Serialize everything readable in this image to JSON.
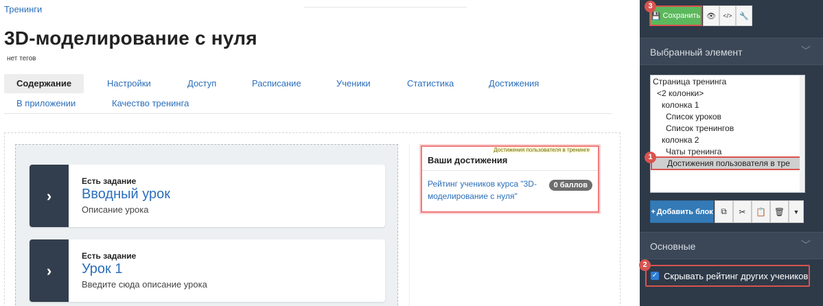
{
  "breadcrumb": "Тренинги",
  "page": {
    "title": "3D-моделирование с нуля",
    "tags": "нет тегов"
  },
  "tabs": [
    {
      "label": "Содержание",
      "active": true
    },
    {
      "label": "Настройки"
    },
    {
      "label": "Доступ"
    },
    {
      "label": "Расписание"
    },
    {
      "label": "Ученики"
    },
    {
      "label": "Статистика"
    },
    {
      "label": "Достижения"
    },
    {
      "label": "В приложении"
    },
    {
      "label": "Качество тренинга"
    }
  ],
  "lessons": [
    {
      "task": "Есть задание",
      "title": "Вводный урок",
      "desc": "Описание урока"
    },
    {
      "task": "Есть задание",
      "title": "Урок 1",
      "desc": "Введите сюда описание урока"
    }
  ],
  "achievements": {
    "caption": "Достижения пользователя в тренинге",
    "title": "Ваши достижения",
    "rating": "Рейтинг учеников курса \"3D-моделирование с нуля\"",
    "badge": "0 баллов"
  },
  "sidebar": {
    "toolbar": {
      "save_label": "Сохранить"
    },
    "selected_section": "Выбранный элемент",
    "tree": [
      "Страница тренинга",
      "<2 колонки>",
      "колонка 1",
      "Список уроков",
      "Список тренингов",
      "колонка 2",
      "Чаты тренинга",
      "Достижения пользователя в тре"
    ],
    "add_block_label": "Добавить блок",
    "main_section": "Основные",
    "hide_rating_label": "Скрывать рейтинг других учеников",
    "hide_rating_checked": true
  },
  "markers": [
    "1",
    "2",
    "3"
  ],
  "colors": {
    "accent": "#2a6ebb",
    "save": "#5cb85c",
    "sidebar": "#2e3a48",
    "highlight": "#d9534f"
  }
}
